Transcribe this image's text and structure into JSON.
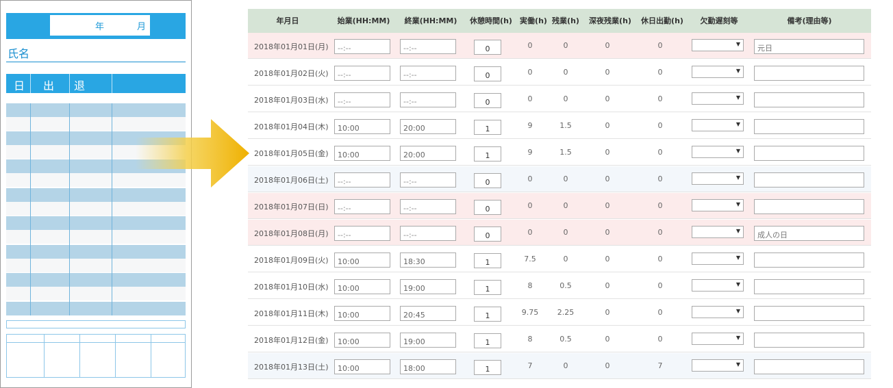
{
  "card": {
    "year_label": "年",
    "month_label": "月",
    "name_label": "氏名",
    "day_label": "日",
    "in_label": "出",
    "out_label": "退"
  },
  "colors": {
    "accent": "#29a6e3",
    "header_bg": "#d6e4d6",
    "holiday_bg": "#fcebeb",
    "arrow": "#f0b400"
  },
  "table": {
    "headers": [
      "年月日",
      "始業(HH:MM)",
      "終業(HH:MM)",
      "休憩時間(h)",
      "実働(h)",
      "残業(h)",
      "深夜残業(h)",
      "休日出勤(h)",
      "欠勤遅刻等",
      "備考(理由等)"
    ],
    "rows": [
      {
        "date": "2018年01月01日(月)",
        "start": "--:--",
        "end": "--:--",
        "break": "0",
        "work": "0",
        "overtime": "0",
        "night": "0",
        "holiday_work": "0",
        "note": "元日",
        "day_type": "holiday"
      },
      {
        "date": "2018年01月02日(火)",
        "start": "--:--",
        "end": "--:--",
        "break": "0",
        "work": "0",
        "overtime": "0",
        "night": "0",
        "holiday_work": "0",
        "note": "",
        "day_type": "weekday"
      },
      {
        "date": "2018年01月03日(水)",
        "start": "--:--",
        "end": "--:--",
        "break": "0",
        "work": "0",
        "overtime": "0",
        "night": "0",
        "holiday_work": "0",
        "note": "",
        "day_type": "weekday"
      },
      {
        "date": "2018年01月04日(木)",
        "start": "10:00",
        "end": "20:00",
        "break": "1",
        "work": "9",
        "overtime": "1.5",
        "night": "0",
        "holiday_work": "0",
        "note": "",
        "day_type": "weekday"
      },
      {
        "date": "2018年01月05日(金)",
        "start": "10:00",
        "end": "20:00",
        "break": "1",
        "work": "9",
        "overtime": "1.5",
        "night": "0",
        "holiday_work": "0",
        "note": "",
        "day_type": "weekday"
      },
      {
        "date": "2018年01月06日(土)",
        "start": "--:--",
        "end": "--:--",
        "break": "0",
        "work": "0",
        "overtime": "0",
        "night": "0",
        "holiday_work": "0",
        "note": "",
        "day_type": "saturday"
      },
      {
        "date": "2018年01月07日(日)",
        "start": "--:--",
        "end": "--:--",
        "break": "0",
        "work": "0",
        "overtime": "0",
        "night": "0",
        "holiday_work": "0",
        "note": "",
        "day_type": "holiday"
      },
      {
        "date": "2018年01月08日(月)",
        "start": "--:--",
        "end": "--:--",
        "break": "0",
        "work": "0",
        "overtime": "0",
        "night": "0",
        "holiday_work": "0",
        "note": "成人の日",
        "day_type": "holiday"
      },
      {
        "date": "2018年01月09日(火)",
        "start": "10:00",
        "end": "18:30",
        "break": "1",
        "work": "7.5",
        "overtime": "0",
        "night": "0",
        "holiday_work": "0",
        "note": "",
        "day_type": "weekday"
      },
      {
        "date": "2018年01月10日(水)",
        "start": "10:00",
        "end": "19:00",
        "break": "1",
        "work": "8",
        "overtime": "0.5",
        "night": "0",
        "holiday_work": "0",
        "note": "",
        "day_type": "weekday"
      },
      {
        "date": "2018年01月11日(木)",
        "start": "10:00",
        "end": "20:45",
        "break": "1",
        "work": "9.75",
        "overtime": "2.25",
        "night": "0",
        "holiday_work": "0",
        "note": "",
        "day_type": "weekday"
      },
      {
        "date": "2018年01月12日(金)",
        "start": "10:00",
        "end": "19:00",
        "break": "1",
        "work": "8",
        "overtime": "0.5",
        "night": "0",
        "holiday_work": "0",
        "note": "",
        "day_type": "weekday"
      },
      {
        "date": "2018年01月13日(土)",
        "start": "10:00",
        "end": "18:00",
        "break": "1",
        "work": "7",
        "overtime": "0",
        "night": "0",
        "holiday_work": "7",
        "note": "",
        "day_type": "saturday"
      }
    ]
  }
}
